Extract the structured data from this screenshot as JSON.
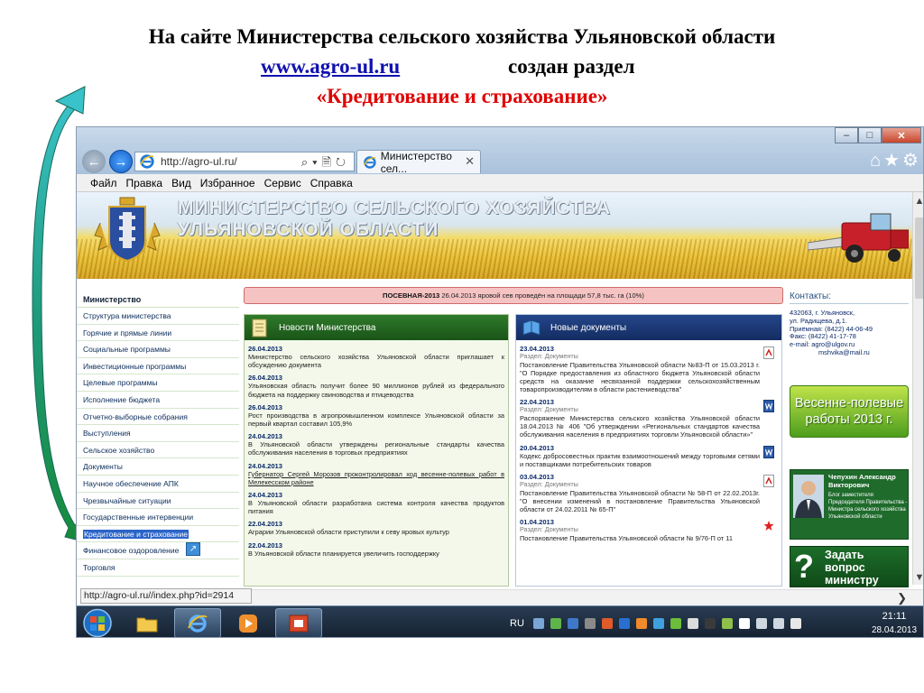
{
  "caption": {
    "line1": "На сайте Министерства сельского хозяйства Ульяновской области",
    "url": "www.agro-ul.ru",
    "line2_rest": "создан раздел",
    "line3": "«Кредитование и страхование»"
  },
  "browser": {
    "address": "http://agro-ul.ru/",
    "tab_title": "Министерство сел...",
    "tab_close": "✕",
    "win_min": "–",
    "win_max": "□",
    "win_close": "✕",
    "toolbar_icons": "⌂★⚙",
    "address_tools": "⌕▾🗎↻",
    "menu": [
      "Файл",
      "Правка",
      "Вид",
      "Избранное",
      "Сервис",
      "Справка"
    ],
    "status_url": "http://agro-ul.ru//index.php?id=2914"
  },
  "banner": {
    "line1": "МИНИСТЕРСТВО СЕЛЬСКОГО ХОЗЯЙСТВА",
    "line2": "УЛЬЯНОВСКОЙ ОБЛАСТИ"
  },
  "left_menu": {
    "head": "Министерство",
    "items": [
      "Структура министерства",
      "Горячие и прямые линии",
      "Социальные программы",
      "Инвестиционные программы",
      "Целевые программы",
      "Исполнение бюджета",
      "Отчетно-выборные собрания",
      "Выступления",
      "Сельское хозяйство",
      "Документы",
      "Научное обеспечение АПК",
      "Чрезвычайные ситуации",
      "Государственные интервенции",
      "Кредитование и страхование",
      "Финансовое оздоровление",
      "Торговля"
    ],
    "selected_index": 13
  },
  "alert": {
    "label": "ПОСЕВНАЯ-2013",
    "text": "26.04.2013 яровой сев проведён на площади 57,8 тыс. га (10%)"
  },
  "news": {
    "title": "Новости Министерства",
    "items": [
      {
        "date": "26.04.2013",
        "text": "Министерство сельского хозяйства Ульяновской области приглашает к обсуждению документа"
      },
      {
        "date": "26.04.2013",
        "text": "Ульяновская область получит более 90 миллионов рублей из федерального бюджета на поддержку свиноводства и птицеводства"
      },
      {
        "date": "26.04.2013",
        "text": "Рост производства в агропромышленном комплексе Ульяновской области за первый квартал составил 105,9%"
      },
      {
        "date": "24.04.2013",
        "text": "В Ульяновской области утверждены региональные стандарты качества обслуживания населения в торговых предприятиях"
      },
      {
        "date": "24.04.2013",
        "text": "Губернатор Сергей Морозов проконтролировал ход весенне-полевых работ в Мелекесском районе"
      },
      {
        "date": "24.04.2013",
        "text": "В Ульяновской области разработана система контроля качества продуктов питания"
      },
      {
        "date": "22.04.2013",
        "text": "Аграрии Ульяновской области приступили к севу яровых культур"
      },
      {
        "date": "22.04.2013",
        "text": "В Ульяновской области планируется увеличить господдержку"
      }
    ]
  },
  "docs": {
    "title": "Новые документы",
    "items": [
      {
        "date": "23.04.2013",
        "section": "Раздел: Документы",
        "text": "Постановление Правительства Ульяновской области №83-П от 15.03.2013 г. \"О Порядке предоставления из областного бюджета Ульяновской области средств на оказание несвязанной поддержки сельскохозяйственным товаропроизводителям в области растениеводства\"",
        "icon": "pdf-icon"
      },
      {
        "date": "22.04.2013",
        "section": "Раздел: Документы",
        "text": "Распоряжение Министерства сельского хозяйства Ульяновской области 18.04.2013 № 406 \"Об утверждении «Региональных стандартов качества обслуживания населения в предприятиях торговли Ульяновской области»\"",
        "icon": "word-icon"
      },
      {
        "date": "20.04.2013",
        "section": "Раздел: Документы",
        "text": "Кодекс добросовестных практик взаимоотношений между торговыми сетями и поставщиками потребительских товаров",
        "icon": "word-icon"
      },
      {
        "date": "03.04.2013",
        "section": "Раздел: Документы",
        "text": "Постановление Правительства Ульяновской области № 58-П от 22.02.2013г. \"О внесении изменений в постановление Правительства Ульяновской области от 24.02.2011 № 65-П\"",
        "icon": "pdf-icon"
      },
      {
        "date": "01.04.2013",
        "section": "Раздел: Документы",
        "text": "Постановление Правительства Ульяновской области № 9/76-П от 11",
        "icon": "pdf-red-icon"
      }
    ]
  },
  "contacts": {
    "title": "Контакты:",
    "lines": [
      "432063, г. Ульяновск,",
      "ул. Радищева, д.1.",
      "Приёмная: (8422) 44-06-49",
      "Факс: (8422) 41-17-78",
      "e-mail: agro@ulgov.ru"
    ],
    "extra_email": "mshvika@mail.ru"
  },
  "promo": {
    "line1": "Весенне-полевые",
    "line2": "работы 2013 г."
  },
  "deputy": {
    "name": "Чепухин Александр Викторович",
    "position": "Блог заместителя Председателя Правительства - Министра сельского хозяйства Ульяновской области"
  },
  "ask": {
    "symbol": "?",
    "line1": "Задать",
    "line2": "вопрос",
    "line3": "министру"
  },
  "taskbar": {
    "lang": "RU",
    "time": "21:11",
    "date": "28.04.2013"
  },
  "colors": {
    "caption_url": "#1010b0",
    "caption_section": "#e00000",
    "news_header": "#1a5418",
    "docs_header": "#142c62",
    "alert_bg": "#f6c3c3",
    "arrow": "#1f9a8a"
  }
}
